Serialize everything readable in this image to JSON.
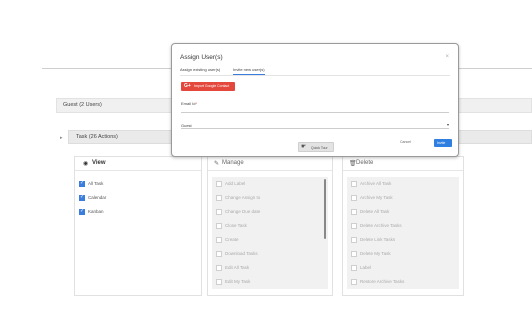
{
  "background": {
    "guest_bar": "Guest  (2 Users)",
    "task_bar": "Task  (26 Actions)",
    "task_arrow": "▸"
  },
  "columns": {
    "view": {
      "title": "View",
      "icon": "eye-icon",
      "icon_glyph": "◉",
      "items": [
        {
          "label": "All Task",
          "checked": true
        },
        {
          "label": "Calendar",
          "checked": true
        },
        {
          "label": "Kanban",
          "checked": true
        }
      ]
    },
    "manage": {
      "title": "Manage",
      "icon": "pencil-icon",
      "icon_glyph": "✎",
      "items": [
        {
          "label": "Add Label"
        },
        {
          "label": "Change Assign to"
        },
        {
          "label": "Change Due date"
        },
        {
          "label": "Close Task"
        },
        {
          "label": "Create"
        },
        {
          "label": "Download Tasks"
        },
        {
          "label": "Edit All Task"
        },
        {
          "label": "Edit My Task"
        }
      ]
    },
    "delete": {
      "title": "Delete",
      "icon": "trash-icon",
      "icon_glyph": "🗑",
      "items": [
        {
          "label": "Archive All Task"
        },
        {
          "label": "Archive My Task"
        },
        {
          "label": "Delete All Task"
        },
        {
          "label": "Delete Archive Tasks"
        },
        {
          "label": "Delete Link Tasks"
        },
        {
          "label": "Delete My Task"
        },
        {
          "label": "Label"
        },
        {
          "label": "Restore Archive Tasks"
        }
      ]
    }
  },
  "modal": {
    "title": "Assign User(s)",
    "close": "×",
    "tabs": [
      {
        "label": "Assign existing user(s)",
        "active": false
      },
      {
        "label": "Invite new user(s)",
        "active": true
      }
    ],
    "import_button": {
      "icon": "G+",
      "label": "Import Google Contact"
    },
    "email_label": "Email Id",
    "email_required": "*",
    "role_value": "Guest",
    "role_caret": "▾",
    "cancel_label": "Cancel",
    "invite_label": "Invite"
  },
  "quick_tour": {
    "label": "Quick Tour",
    "icon_glyph": "☛"
  },
  "colors": {
    "accent": "#2f7fe0",
    "google_red": "#e4473b",
    "checkbox_checked": "#3b7ddd"
  }
}
